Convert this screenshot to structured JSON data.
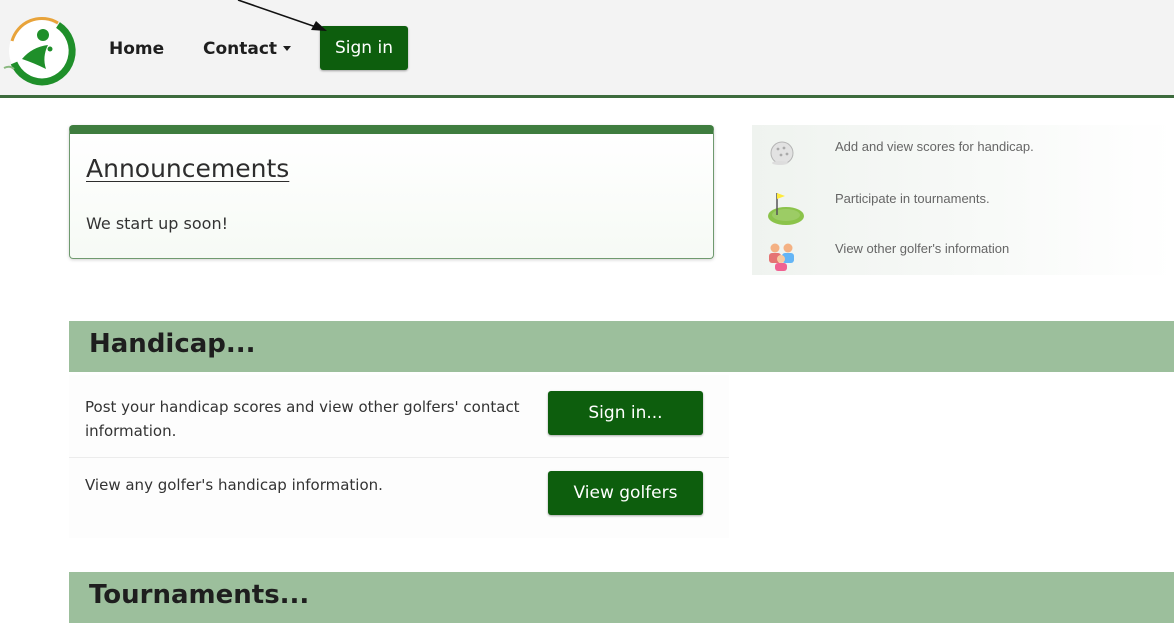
{
  "navbar": {
    "home_label": "Home",
    "contact_label": "Contact",
    "signin_label": "Sign in"
  },
  "announcements": {
    "title": "Announcements",
    "text": "We start up soon!"
  },
  "features": [
    {
      "icon": "golf-ball-icon",
      "text": "Add and view scores for handicap."
    },
    {
      "icon": "golf-green-flag-icon",
      "text": "Participate in tournaments."
    },
    {
      "icon": "golfers-group-icon",
      "text": "View other golfer's information"
    }
  ],
  "handicap": {
    "title": "Handicap...",
    "rows": [
      {
        "text": "Post your handicap scores and view other golfers' contact information.",
        "button": "Sign in..."
      },
      {
        "text": "View any golfer's handicap information.",
        "button": "View golfers"
      }
    ]
  },
  "tournaments": {
    "title": "Tournaments..."
  },
  "colors": {
    "brand_green": "#0d5e0d",
    "section_header_bg": "#9cbf9c",
    "nav_border": "#3d6b3d",
    "card_top_border": "#3f7d3f"
  }
}
